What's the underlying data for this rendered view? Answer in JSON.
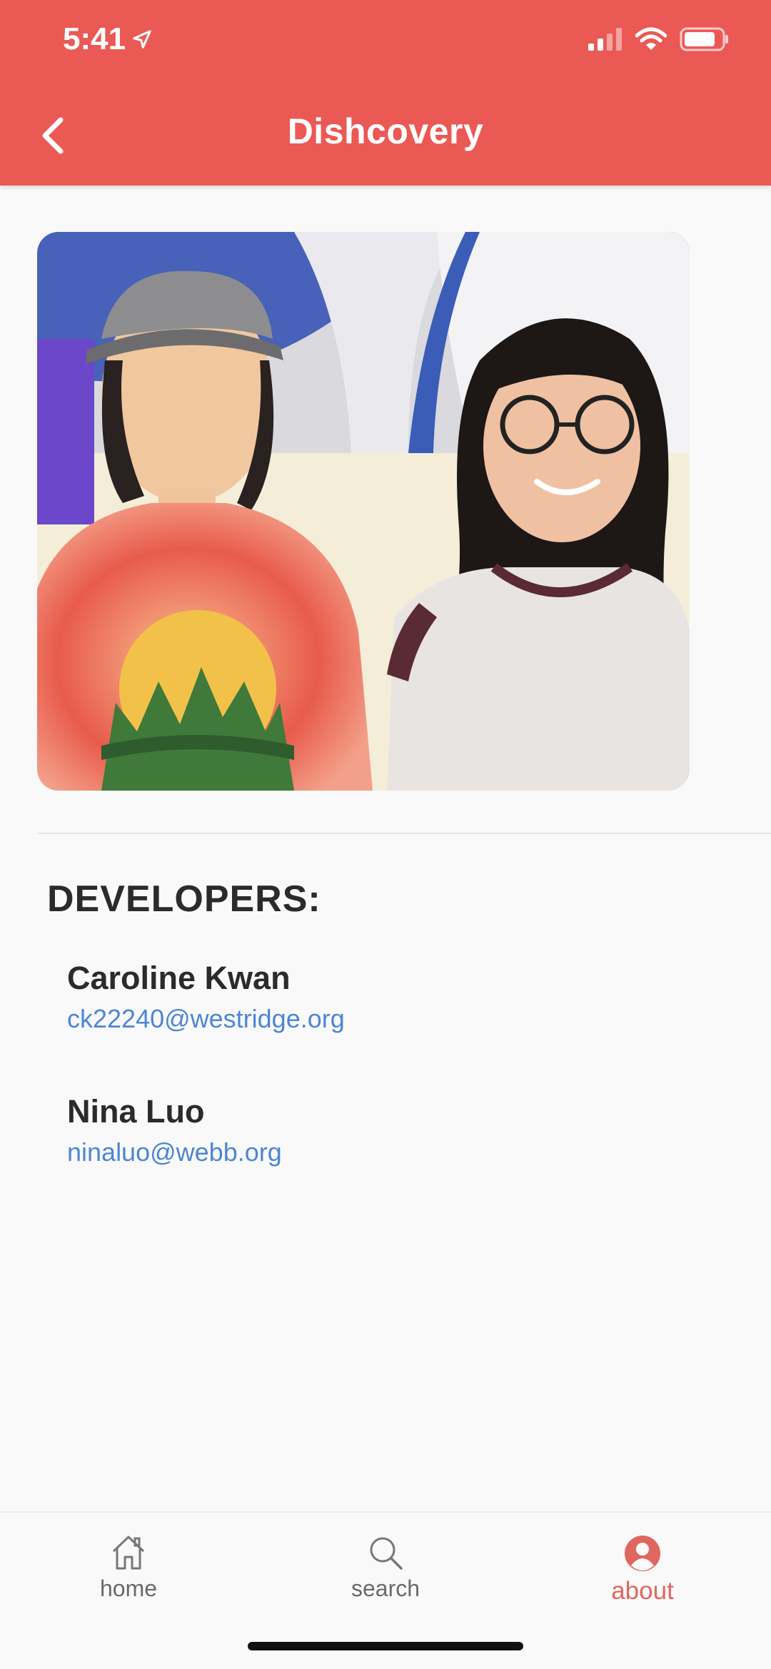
{
  "status_bar": {
    "time": "5:41"
  },
  "nav": {
    "title": "Dishcovery"
  },
  "section": {
    "title": "DEVELOPERS:"
  },
  "developers": [
    {
      "name": "Caroline Kwan",
      "email": "ck22240@westridge.org"
    },
    {
      "name": "Nina Luo",
      "email": "ninaluo@webb.org"
    }
  ],
  "tabs": [
    {
      "label": "home",
      "icon": "home-icon"
    },
    {
      "label": "search",
      "icon": "search-icon"
    },
    {
      "label": "about",
      "icon": "person-circle-icon",
      "active": true
    }
  ],
  "colors": {
    "header": "#eb5955",
    "accent": "#e0675f",
    "link": "#4d86d4"
  }
}
